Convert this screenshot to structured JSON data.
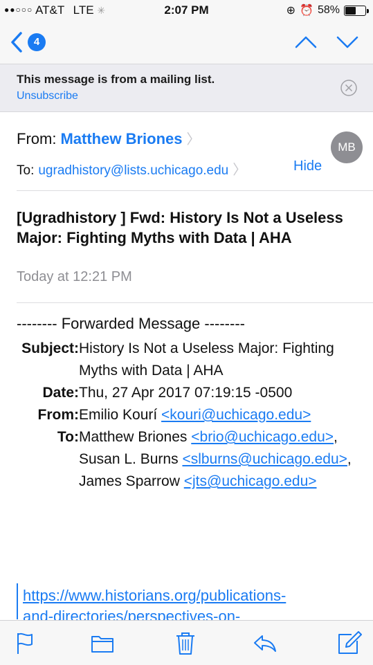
{
  "status": {
    "carrier": "AT&T",
    "network": "LTE",
    "time": "2:07 PM",
    "battery": "58%",
    "battery_level": 0.58
  },
  "nav": {
    "unread_count": "4"
  },
  "banner": {
    "message": "This message is from a mailing list.",
    "unsubscribe": "Unsubscribe"
  },
  "header": {
    "from_label": "From:",
    "from_name": "Matthew Briones",
    "to_label": "To:",
    "to_address": "ugradhistory@lists.uchicago.edu",
    "hide_label": "Hide",
    "avatar_initials": "MB"
  },
  "email": {
    "subject": "[Ugradhistory ] Fwd: History Is Not a Useless Major: Fighting Myths with Data | AHA",
    "date": "Today at 12:21 PM"
  },
  "body": {
    "forwarded": "-------- Forwarded Message --------",
    "subject_label": "Subject:",
    "subject_value": "History Is Not a Useless Major: Fighting Myths with Data | AHA",
    "date_label": "Date:",
    "date_value": "Thu, 27 Apr 2017 07:19:15 -0500",
    "from_label": "From:",
    "from_name": "Emilio Kourí",
    "from_email": "<kouri@uchicago.edu>",
    "to_label": "To:",
    "to_1_name": "Matthew Briones",
    "to_1_email": "<brio@uchicago.edu>",
    "to_2_name": ", Susan L. Burns",
    "to_2_email": "<slburns@uchicago.edu>",
    "to_3_name": ", James Sparrow",
    "to_3_email": "<jts@uchicago.edu>",
    "link_line1": "https://www.historians.org/publications-",
    "link_line2": "and-directories/perspectives-on-"
  },
  "toolbar": {
    "icons": [
      "flag-icon",
      "folder-icon",
      "trash-icon",
      "reply-icon",
      "compose-icon"
    ]
  },
  "colors": {
    "accent": "#1a7bf2",
    "secondary_text": "#8e8e93",
    "banner_bg": "#ececf1"
  }
}
